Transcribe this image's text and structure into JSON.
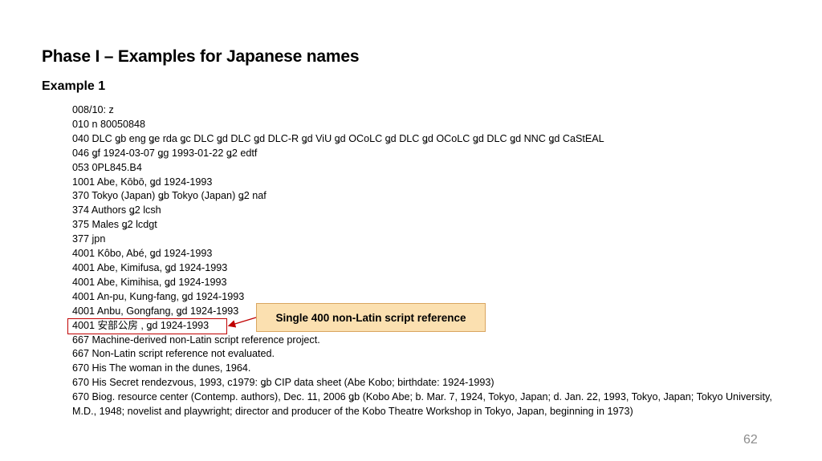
{
  "slide": {
    "title": "Phase I – Examples for Japanese names",
    "subtitle": "Example 1",
    "page_number": "62"
  },
  "record_lines": [
    "008/10: z",
    "010  n  80050848",
    "040  DLC ǥb eng ǥe rda ǥc DLC ǥd DLC ǥd DLC-R ǥd ViU ǥd OCoLC ǥd DLC ǥd OCoLC ǥd DLC ǥd NNC ǥd CaStEAL",
    "046  ǥf 1924-03-07 ǥg 1993-01-22 ǥ2 edtf",
    "053 0PL845.B4",
    "1001 Abe, Kōbō, ǥd 1924-1993",
    "370  Tokyo (Japan) ǥb Tokyo (Japan) ǥ2 naf",
    "374  Authors ǥ2 lcsh",
    "375  Males ǥ2 lcdgt",
    "377  jpn",
    "4001 Kôbo, Abé, ǥd 1924-1993",
    "4001 Abe, Kimifusa, ǥd 1924-1993",
    "4001 Abe, Kimihisa, ǥd 1924-1993",
    "4001 An-pu, Kung-fang, ǥd 1924-1993",
    "4001 Anbu, Gongfang, ǥd 1924-1993",
    "4001  安部公房 , ǥd 1924-1993",
    "667  Machine-derived non-Latin script reference project.",
    "667  Non-Latin script reference not evaluated.",
    "670  His The woman in the dunes, 1964.",
    "670  His Secret rendezvous, 1993, c1979: ǥb CIP data sheet (Abe Kobo; birthdate: 1924-1993)",
    "670  Biog. resource center (Contemp. authors), Dec. 11, 2006 ǥb (Kobo Abe; b. Mar. 7, 1924, Tokyo, Japan; d. Jan. 22, 1993, Tokyo, Japan; Tokyo University, M.D., 1948; novelist and playwright; director and producer of the Kobo Theatre Workshop in Tokyo, Japan, beginning in 1973)"
  ],
  "callout": {
    "label": "Single 400 non-Latin script reference",
    "fill_color": "#fbe0b0",
    "highlight_color": "#c00000"
  }
}
